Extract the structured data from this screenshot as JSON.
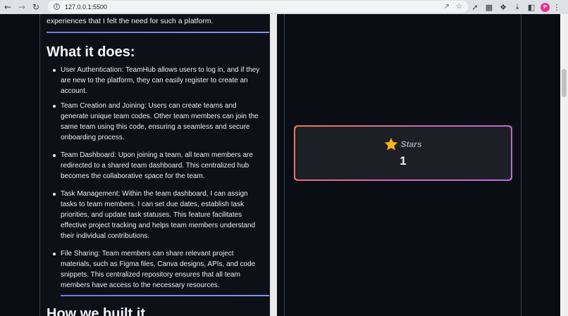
{
  "browser": {
    "url": "127.0.0.1:5500",
    "profile_initial": "P"
  },
  "page": {
    "intro_tail": "experiences that I felt the need for such a platform.",
    "section_title": "What it does:",
    "features": [
      "User Authentication: TeamHub allows users to log in, and if they are new to the platform, they can easily register to create an account.",
      "Team Creation and Joining: Users can create teams and generate unique team codes. Other team members can join the same team using this code, ensuring a seamless and secure onboarding process.",
      "Team Dashboard: Upon joining a team, all team members are redirected to a shared team dashboard. This centralized hub becomes the collaborative space for the team.",
      "Task Management: Within the team dashboard, I can assign tasks to team members. I can set due dates, establish task priorities, and update task statuses. This feature facilitates effective project tracking and helps team members understand their individual contributions.",
      "File Sharing: Team members can share relevant project materials, such as Figma files, Canva designs, APIs, and code snippets. This centralized repository ensures that all team members have access to the necessary resources."
    ],
    "next_section_title": "How we built it"
  },
  "stars_card": {
    "label": "Stars",
    "count": "1",
    "icon": "star-icon"
  },
  "colors": {
    "background": "#0b0d14",
    "accent_rule": "#7480e0",
    "star": "#f5b81b",
    "card_border_start": "#f07a4a",
    "card_border_end": "#b56fd6"
  }
}
